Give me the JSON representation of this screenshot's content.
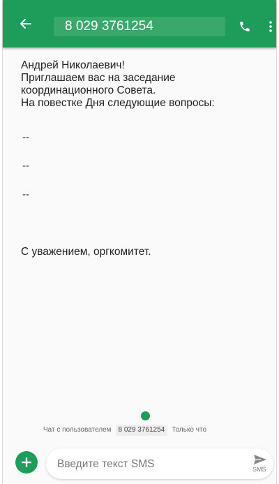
{
  "header": {
    "title": "8 029 3761254",
    "back_icon": "arrow-left-icon",
    "call_icon": "phone-icon",
    "menu_icon": "more-vert-icon"
  },
  "message": {
    "lines": [
      "Андрей Николаевич!",
      "Приглашаем вас на заседание",
      "координационного Совета.",
      "На повестке Дня следующие вопросы:"
    ],
    "items": [
      "--",
      "--",
      "--"
    ],
    "signature": "С уважением, оргкомитет."
  },
  "chat_info": {
    "prefix": "Чат с пользователем",
    "number": "8 029 3761254",
    "time": "Только что"
  },
  "compose": {
    "placeholder": "Введите текст SMS",
    "send_label": "SMS"
  },
  "colors": {
    "accent": "#1d9c5a",
    "title_box": "#3aa86b",
    "background": "#fafafa"
  }
}
